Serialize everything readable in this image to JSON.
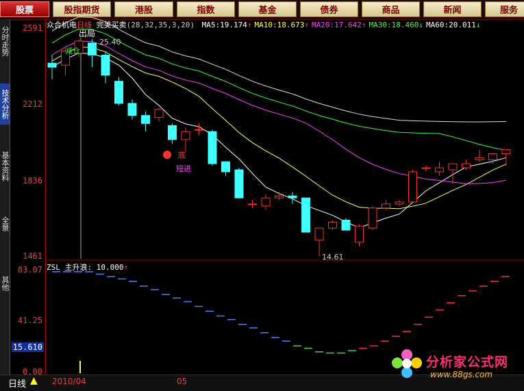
{
  "tabs": [
    "股票",
    "股指期货",
    "港股",
    "指数",
    "基金",
    "债券",
    "商品",
    "新闻",
    "服务"
  ],
  "active_tab": 0,
  "sidebar": [
    "分时走势",
    "技术分析",
    "基本资料",
    "全景",
    "其他"
  ],
  "sidebar_active": 1,
  "header": {
    "stock_name": "众合机电",
    "period": "日线",
    "indicator": "完美买卖",
    "params": "(28,32,35,3,20)",
    "ma": [
      {
        "label": "MA5:",
        "value": "19.174",
        "arrow": "↑",
        "color": "#ffffff"
      },
      {
        "label": "MA10:",
        "value": "18.673",
        "arrow": "↑",
        "color": "#ffff60"
      },
      {
        "label": "MA20:",
        "value": "17.642",
        "arrow": "↑",
        "color": "#ff40ff"
      },
      {
        "label": "MA30:",
        "value": "18.460",
        "arrow": "↓",
        "color": "#40ff40"
      },
      {
        "label": "MA60:",
        "value": "20.011",
        "arrow": "↓",
        "color": "#ffffff"
      }
    ]
  },
  "price_axis": {
    "labels": [
      "2591",
      "2212",
      "1836",
      "1461"
    ],
    "min": 14.61,
    "max": 25.91
  },
  "annotations": {
    "exit": "出局",
    "high": "25.40",
    "reduce": "减仓",
    "bottom": "底",
    "short_entry": "短进",
    "low": "14.61"
  },
  "sub_header": {
    "name": "ZSL",
    "line": "主升浪:",
    "value": "10.000",
    "arrow": "↑"
  },
  "sub_axis": {
    "labels": [
      "83.07",
      "41.25",
      "0.00"
    ],
    "current": "15.610"
  },
  "bottom": {
    "period": "日线",
    "date1": "2010/04",
    "date2": "05"
  },
  "watermark": {
    "brand": "分析家公式网",
    "url": "www.88gs.com"
  },
  "chart_data": {
    "type": "candlestick",
    "ohlc": [
      [
        24.2,
        24.6,
        23.4,
        24.0
      ],
      [
        24.1,
        24.9,
        23.6,
        24.8
      ],
      [
        24.7,
        25.4,
        24.5,
        25.3
      ],
      [
        25.2,
        25.4,
        24.0,
        24.6
      ],
      [
        24.6,
        24.8,
        23.2,
        23.6
      ],
      [
        23.3,
        23.5,
        22.1,
        22.2
      ],
      [
        22.2,
        22.4,
        21.4,
        21.6
      ],
      [
        21.6,
        21.8,
        20.8,
        21.2
      ],
      [
        21.5,
        22.0,
        21.3,
        21.9
      ],
      [
        21.1,
        21.2,
        20.2,
        20.4
      ],
      [
        20.4,
        21.0,
        19.8,
        20.8
      ],
      [
        20.9,
        21.2,
        20.6,
        20.9
      ],
      [
        20.8,
        20.9,
        19.1,
        19.2
      ],
      [
        19.3,
        19.3,
        18.6,
        18.8
      ],
      [
        18.9,
        19.0,
        17.5,
        17.5
      ],
      [
        17.2,
        17.4,
        17.0,
        17.2
      ],
      [
        17.1,
        17.7,
        16.9,
        17.5
      ],
      [
        17.5,
        17.8,
        17.4,
        17.6
      ],
      [
        17.6,
        17.8,
        17.2,
        17.5
      ],
      [
        17.5,
        17.5,
        15.8,
        15.8
      ],
      [
        15.4,
        16.0,
        14.6,
        16.0
      ],
      [
        16.0,
        16.4,
        15.9,
        16.3
      ],
      [
        16.4,
        16.5,
        15.9,
        15.9
      ],
      [
        15.3,
        16.2,
        15.1,
        16.1
      ],
      [
        16.0,
        17.1,
        15.9,
        17.0
      ],
      [
        17.0,
        17.4,
        16.9,
        17.2
      ],
      [
        17.2,
        17.4,
        17.1,
        17.3
      ],
      [
        17.3,
        18.9,
        17.3,
        18.8
      ],
      [
        19.0,
        19.1,
        18.8,
        19.0
      ],
      [
        18.8,
        19.3,
        18.6,
        19.0
      ],
      [
        18.9,
        19.2,
        18.2,
        19.2
      ],
      [
        19.0,
        19.4,
        18.9,
        19.2
      ],
      [
        19.4,
        19.9,
        19.3,
        19.5
      ],
      [
        19.4,
        19.7,
        19.2,
        19.7
      ],
      [
        19.7,
        19.9,
        19.1,
        19.9
      ]
    ],
    "zsl": [
      82,
      82,
      82,
      82,
      80,
      78,
      76,
      74,
      70,
      67,
      63,
      60,
      57,
      53,
      49,
      45,
      42,
      38,
      35,
      31,
      27,
      24,
      20,
      18,
      15,
      14,
      14,
      16,
      18,
      20,
      24,
      28,
      32,
      38,
      44,
      50,
      56,
      62,
      66,
      70,
      74,
      78
    ]
  }
}
